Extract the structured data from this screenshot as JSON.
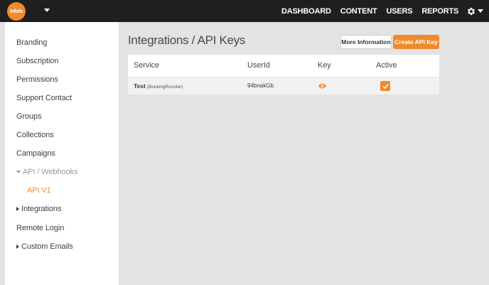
{
  "brand": {
    "logo_text": "infofo",
    "accent_color": "#ef8a2e"
  },
  "nav": {
    "items": [
      "DASHBOARD",
      "CONTENT",
      "USERS",
      "REPORTS"
    ],
    "settings_icon": "gear-icon"
  },
  "sidebar": {
    "items": [
      {
        "label": "Branding"
      },
      {
        "label": "Subscription"
      },
      {
        "label": "Permissions"
      },
      {
        "label": "Support Contact"
      },
      {
        "label": "Groups"
      },
      {
        "label": "Collections"
      },
      {
        "label": "Campaigns"
      },
      {
        "label": "API / Webhooks",
        "expanded": true
      },
      {
        "label": "API V1",
        "active": true
      },
      {
        "label": "Integrations",
        "expandable": true
      },
      {
        "label": "Remote Login"
      },
      {
        "label": "Custom Emails",
        "expandable": true
      }
    ]
  },
  "main": {
    "title": "Integrations / API Keys",
    "buttons": {
      "more_info": "More Information",
      "create": "Create API Key"
    },
    "table": {
      "columns": [
        "Service",
        "UserId",
        "Key",
        "Active"
      ],
      "rows": [
        {
          "service": "Test",
          "service_sub": "(BookingRooster)",
          "user_id": "94bnakGb",
          "key_icon": "eye-icon",
          "active": true
        }
      ]
    }
  }
}
